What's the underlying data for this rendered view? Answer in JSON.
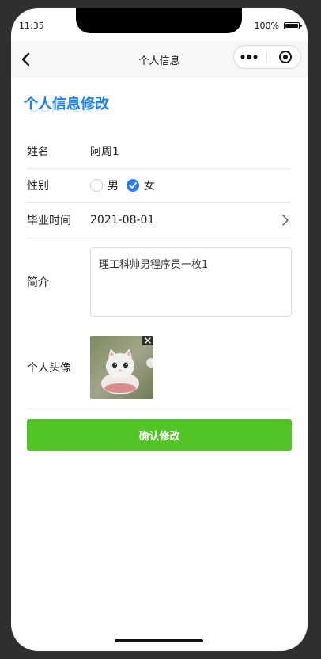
{
  "status_bar": {
    "time": "11:35",
    "battery_text": "100%"
  },
  "navbar": {
    "title": "个人信息"
  },
  "section": {
    "title": "个人信息修改",
    "bg_word": "CONTENT"
  },
  "form": {
    "name": {
      "label": "姓名",
      "value": "阿周1"
    },
    "gender": {
      "label": "性别",
      "options": [
        {
          "label": "男",
          "checked": false
        },
        {
          "label": "女",
          "checked": true
        }
      ]
    },
    "graduation": {
      "label": "毕业时间",
      "value": "2021-08-01"
    },
    "intro": {
      "label": "简介",
      "value": "理工科帅男程序员一枚1"
    },
    "avatar": {
      "label": "个人头像"
    }
  },
  "submit": {
    "label": "确认修改"
  },
  "colors": {
    "accent_blue": "#1f7fe5",
    "radio_checked": "#2b7cf0",
    "submit_green": "#52c526"
  }
}
